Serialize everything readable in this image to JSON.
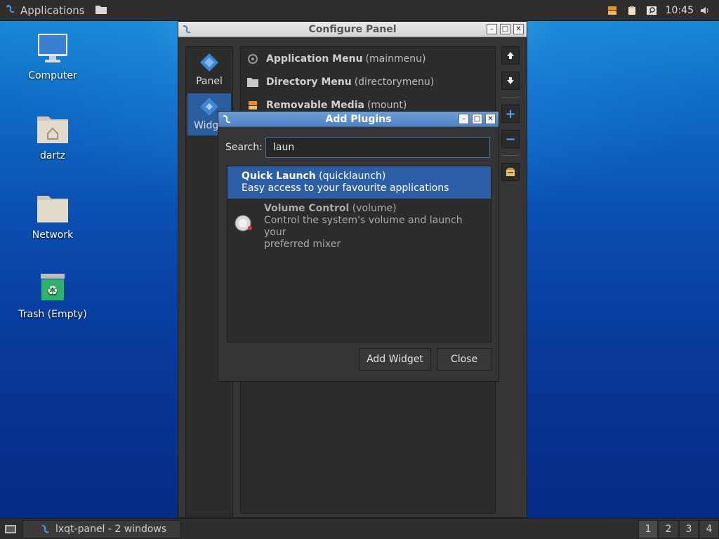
{
  "top_panel": {
    "applications_label": "Applications",
    "clock": "10:45"
  },
  "desktop_icons": [
    {
      "label": "Computer"
    },
    {
      "label": "dartz"
    },
    {
      "label": "Network"
    },
    {
      "label": "Trash (Empty)"
    }
  ],
  "configure_panel": {
    "title": "Configure Panel",
    "sidebar": [
      {
        "label": "Panel"
      },
      {
        "label": "Widge"
      }
    ],
    "widgets": [
      {
        "name": "Application Menu",
        "id": "(mainmenu)"
      },
      {
        "name": "Directory Menu",
        "id": "(directorymenu)"
      },
      {
        "name": "Removable Media",
        "id": "(mount)"
      }
    ],
    "tools": {
      "up": "⬆",
      "down": "⬇",
      "add": "+",
      "remove": "−"
    }
  },
  "add_plugins": {
    "title": "Add Plugins",
    "search_label": "Search:",
    "search_value": "laun",
    "plugins": [
      {
        "name": "Quick Launch",
        "id": "(quicklaunch)",
        "desc": "Easy access to your favourite applications"
      },
      {
        "name": "Volume Control",
        "id": "(volume)",
        "desc": "Control the system's volume and launch your",
        "desc2": "preferred mixer"
      }
    ],
    "add_button": "Add Widget",
    "close_button": "Close"
  },
  "bottom_panel": {
    "task_label": "lxqt-panel - 2 windows",
    "desktops": [
      "1",
      "2",
      "3",
      "4"
    ]
  },
  "colors": {
    "accent": "#2b5ea5",
    "dialog_title": "#5b8cc9"
  }
}
